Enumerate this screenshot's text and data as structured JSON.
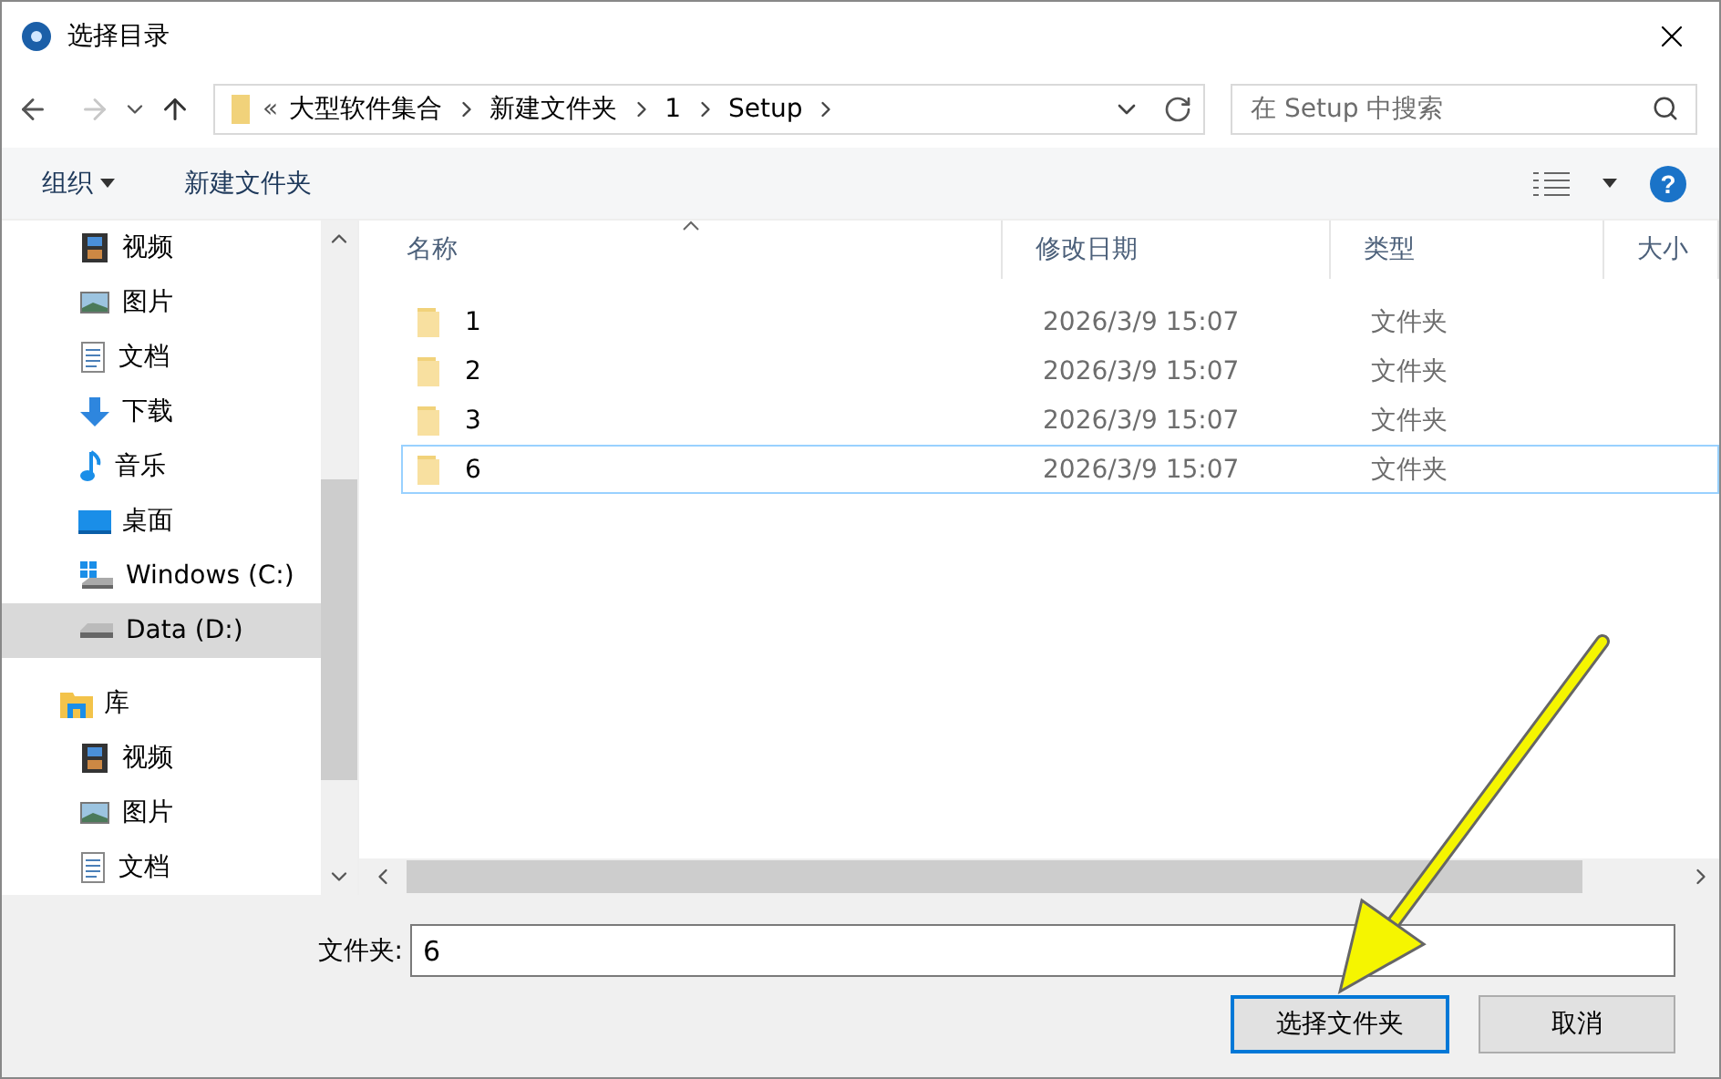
{
  "window": {
    "title": "选择目录"
  },
  "navigation": {
    "back_disabled": false,
    "forward_disabled": true
  },
  "address": {
    "overflow": "«",
    "segments": [
      "大型软件集合",
      "新建文件夹",
      "1",
      "Setup"
    ]
  },
  "search": {
    "placeholder": "在 Setup 中搜索"
  },
  "toolbar": {
    "organize": "组织",
    "new_folder": "新建文件夹",
    "help": "?"
  },
  "sidebar": {
    "items": [
      {
        "label": "视频",
        "kind": "video",
        "selected": false
      },
      {
        "label": "图片",
        "kind": "pictures",
        "selected": false
      },
      {
        "label": "文档",
        "kind": "documents",
        "selected": false
      },
      {
        "label": "下载",
        "kind": "downloads",
        "selected": false
      },
      {
        "label": "音乐",
        "kind": "music",
        "selected": false
      },
      {
        "label": "桌面",
        "kind": "desktop",
        "selected": false
      },
      {
        "label": "Windows (C:)",
        "kind": "system-drive",
        "selected": false
      },
      {
        "label": "Data (D:)",
        "kind": "drive",
        "selected": true
      }
    ],
    "tree": [
      {
        "label": "库",
        "kind": "library",
        "selected": false,
        "children": [
          {
            "label": "视频",
            "kind": "video",
            "selected": false
          },
          {
            "label": "图片",
            "kind": "pictures",
            "selected": false
          },
          {
            "label": "文档",
            "kind": "documents",
            "selected": false
          }
        ]
      }
    ]
  },
  "table": {
    "columns": [
      "名称",
      "修改日期",
      "类型",
      "大小"
    ],
    "rows": [
      {
        "name": "1",
        "modified": "2026/3/9 15:07",
        "type": "文件夹",
        "focused": false
      },
      {
        "name": "2",
        "modified": "2026/3/9 15:07",
        "type": "文件夹",
        "focused": false
      },
      {
        "name": "3",
        "modified": "2026/3/9 15:07",
        "type": "文件夹",
        "focused": false
      },
      {
        "name": "6",
        "modified": "2026/3/9 15:07",
        "type": "文件夹",
        "focused": true
      }
    ]
  },
  "folder_field": {
    "label": "文件夹:",
    "value": "6"
  },
  "buttons": [
    {
      "label": "选择文件夹",
      "default": true
    },
    {
      "label": "取消",
      "default": false
    }
  ],
  "annotation": {
    "kind": "arrow"
  }
}
